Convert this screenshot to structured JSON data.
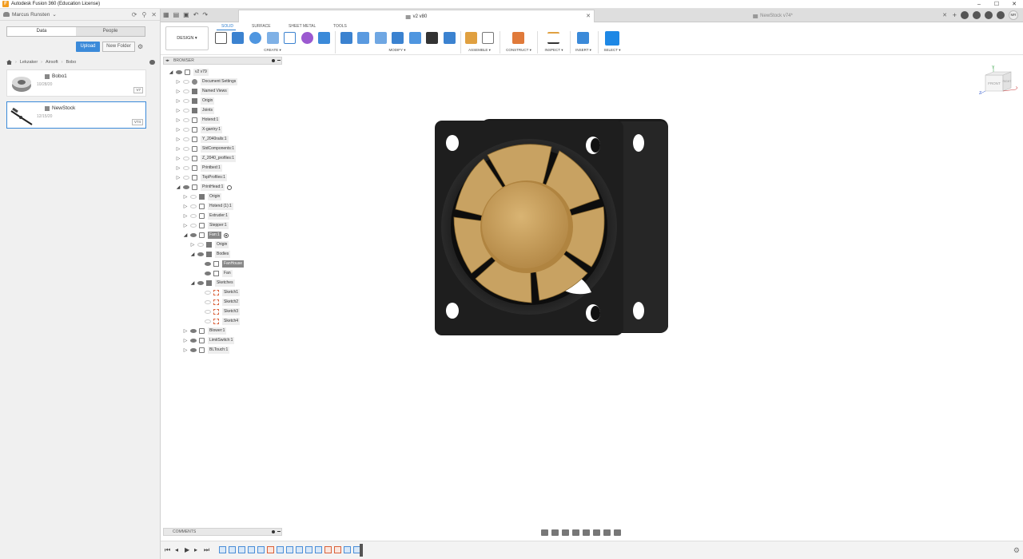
{
  "app": {
    "window_title": "Autodesk Fusion 360 (Education License)",
    "logo_letter": "F",
    "win_min": "–",
    "win_max": "☐",
    "win_close": "✕"
  },
  "data_panel": {
    "user": "Marcus Runsten",
    "tabs": [
      "Data",
      "People"
    ],
    "upload_label": "Upload",
    "new_folder_label": "New Folder",
    "breadcrumb": [
      "Lekzaker",
      "Airsoft",
      "Bobo"
    ],
    "files": [
      {
        "name": "Bobo1",
        "date": "10/28/20",
        "version": "V7"
      },
      {
        "name": "NewStock",
        "date": "12/15/20",
        "version": "V74"
      }
    ]
  },
  "doc_tabs": [
    {
      "label": "v2 v80",
      "active": true
    },
    {
      "label": "NewStock v74*",
      "active": false
    }
  ],
  "toolbar": {
    "workspace": "DESIGN",
    "ws_tabs": [
      "SOLID",
      "SURFACE",
      "SHEET METAL",
      "TOOLS"
    ],
    "groups": [
      "CREATE",
      "MODIFY",
      "ASSEMBLE",
      "CONSTRUCT",
      "INSPECT",
      "INSERT",
      "SELECT"
    ],
    "user_initials": "MR"
  },
  "browser": {
    "label": "BROWSER",
    "rows": [
      {
        "label": "v2 v79"
      },
      {
        "label": "Document Settings"
      },
      {
        "label": "Named Views"
      },
      {
        "label": "Origin"
      },
      {
        "label": "Joints"
      },
      {
        "label": "Hotend:1"
      },
      {
        "label": "X-gantry:1"
      },
      {
        "label": "Y_2040rails:1"
      },
      {
        "label": "StdComponents:1"
      },
      {
        "label": "Z_2040_profiles:1"
      },
      {
        "label": "Printbed:1"
      },
      {
        "label": "TopProfiles:1"
      },
      {
        "label": "PrintHead:1"
      },
      {
        "label": "Origin"
      },
      {
        "label": "Hotend (1):1"
      },
      {
        "label": "Extruder:1"
      },
      {
        "label": "Stepper:1"
      },
      {
        "label": "Fan:1"
      },
      {
        "label": "Origin"
      },
      {
        "label": "Bodies"
      },
      {
        "label": "FanHouse"
      },
      {
        "label": "Fan"
      },
      {
        "label": "Sketches"
      },
      {
        "label": "Sketch1"
      },
      {
        "label": "Sketch2"
      },
      {
        "label": "Sketch3"
      },
      {
        "label": "Sketch4"
      },
      {
        "label": "Blower:1"
      },
      {
        "label": "LimitSwitch:1"
      },
      {
        "label": "BLTouch:1"
      }
    ]
  },
  "viewcube": {
    "front": "FRONT",
    "right": "RIGHT",
    "axis_x": "X",
    "axis_y": "Y",
    "axis_z": "Z"
  },
  "comments": {
    "label": "COMMENTS"
  },
  "colors": {
    "accent": "#3b8ad9",
    "fan_blade": "#c8a262",
    "fan_housing": "#1e1e1e",
    "sketch": "#d9603a"
  }
}
